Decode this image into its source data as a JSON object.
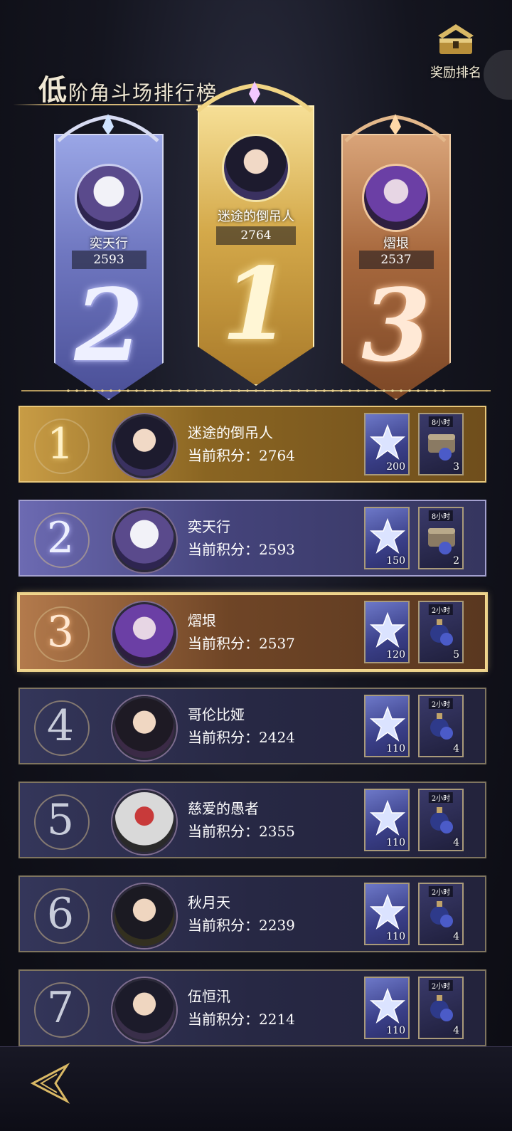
{
  "header": {
    "title_first": "低",
    "title_rest": "阶角斗场排行榜",
    "reward_rank_label": "奖励排名"
  },
  "podium": [
    {
      "place": "2",
      "name": "奕天行",
      "score": "2593"
    },
    {
      "place": "1",
      "name": "迷途的倒吊人",
      "score": "2764"
    },
    {
      "place": "3",
      "name": "熠垠",
      "score": "2537"
    }
  ],
  "score_label": "当前积分：",
  "rows": [
    {
      "rank": "1",
      "name": "迷途的倒吊人",
      "score": "2764",
      "reward1_qty": "200",
      "reward2_tag": "8小时",
      "reward2_qty": "3"
    },
    {
      "rank": "2",
      "name": "奕天行",
      "score": "2593",
      "reward1_qty": "150",
      "reward2_tag": "8小时",
      "reward2_qty": "2"
    },
    {
      "rank": "3",
      "name": "熠垠",
      "score": "2537",
      "reward1_qty": "120",
      "reward2_tag": "2小时",
      "reward2_qty": "5"
    },
    {
      "rank": "4",
      "name": "哥伦比娅",
      "score": "2424",
      "reward1_qty": "110",
      "reward2_tag": "2小时",
      "reward2_qty": "4"
    },
    {
      "rank": "5",
      "name": "慈爱的愚者",
      "score": "2355",
      "reward1_qty": "110",
      "reward2_tag": "2小时",
      "reward2_qty": "4"
    },
    {
      "rank": "6",
      "name": "秋月天",
      "score": "2239",
      "reward1_qty": "110",
      "reward2_tag": "2小时",
      "reward2_qty": "4"
    },
    {
      "rank": "7",
      "name": "伍恒汛",
      "score": "2214",
      "reward1_qty": "110",
      "reward2_tag": "2小时",
      "reward2_qty": "4"
    }
  ],
  "icons": {
    "reward_rank": "treasure-chest-icon",
    "reward1": "star-crystal-icon",
    "reward2": "exp-chest-icon",
    "back": "back-arrow-icon"
  },
  "colors": {
    "gold": "#e8c77a",
    "silver": "#a3a0cf",
    "bronze": "#c58a57",
    "background": "#14151f"
  }
}
